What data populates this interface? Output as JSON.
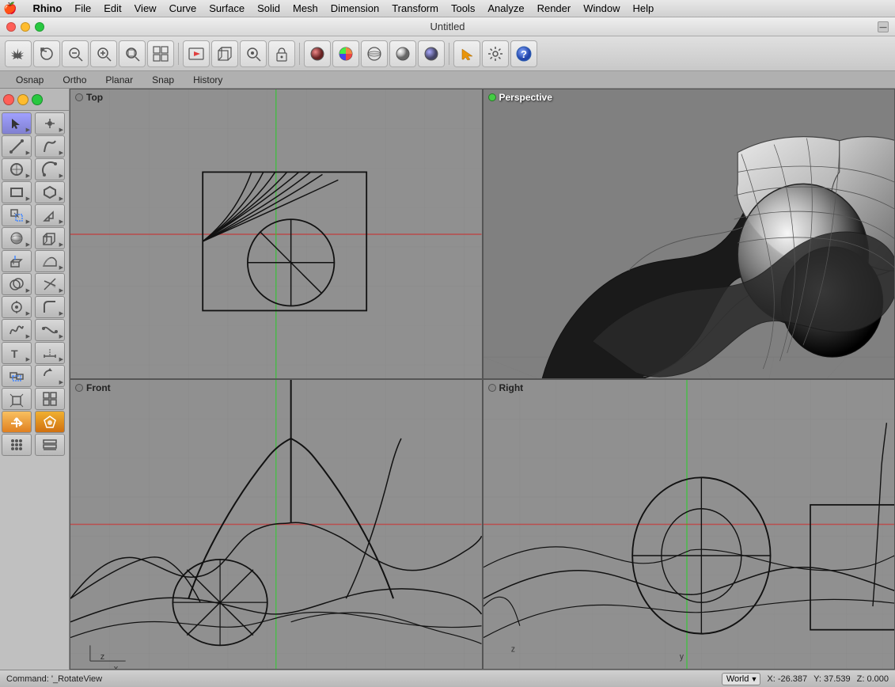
{
  "app": {
    "name": "Rhino",
    "title": "Untitled"
  },
  "menubar": {
    "apple": "🍎",
    "items": [
      "Rhino",
      "File",
      "Edit",
      "View",
      "Curve",
      "Surface",
      "Solid",
      "Mesh",
      "Dimension",
      "Transform",
      "Tools",
      "Analyze",
      "Render",
      "Window",
      "Help"
    ]
  },
  "titlebar": {
    "title": "Untitled",
    "collapse_label": "—"
  },
  "snapbar": {
    "items": [
      "Osnap",
      "Ortho",
      "Planar",
      "Snap",
      "History"
    ]
  },
  "viewports": {
    "top": {
      "label": "Top",
      "dot": "gray"
    },
    "perspective": {
      "label": "Perspective",
      "dot": "green"
    },
    "front": {
      "label": "Front",
      "dot": "gray"
    },
    "right": {
      "label": "Right",
      "dot": "gray"
    }
  },
  "statusbar": {
    "command": "Command: '_RotateView",
    "coord_system": "World",
    "x": "X: -26.387",
    "y": "Y: 37.539",
    "z": "Z: 0.000"
  },
  "toolbar": {
    "tools": [
      {
        "icon": "✋",
        "name": "pan"
      },
      {
        "icon": "⊕",
        "name": "rotate"
      },
      {
        "icon": "🔍",
        "name": "zoom-out"
      },
      {
        "icon": "🔍",
        "name": "zoom-in"
      },
      {
        "icon": "◎",
        "name": "zoom-window"
      },
      {
        "icon": "⊞",
        "name": "four-view"
      },
      {
        "icon": "🚗",
        "name": "render-preview"
      },
      {
        "icon": "⊡",
        "name": "box"
      },
      {
        "icon": "⊙",
        "name": "zoom-selected"
      },
      {
        "icon": "⊠",
        "name": "lock"
      },
      {
        "icon": "◈",
        "name": "shaded"
      },
      {
        "icon": "◉",
        "name": "color"
      },
      {
        "icon": "◍",
        "name": "wireframe"
      },
      {
        "icon": "◐",
        "name": "rendered"
      },
      {
        "icon": "◑",
        "name": "arctic"
      },
      {
        "icon": "➤",
        "name": "arrow-tool"
      },
      {
        "icon": "⚙",
        "name": "settings"
      },
      {
        "icon": "?",
        "name": "help"
      }
    ]
  }
}
